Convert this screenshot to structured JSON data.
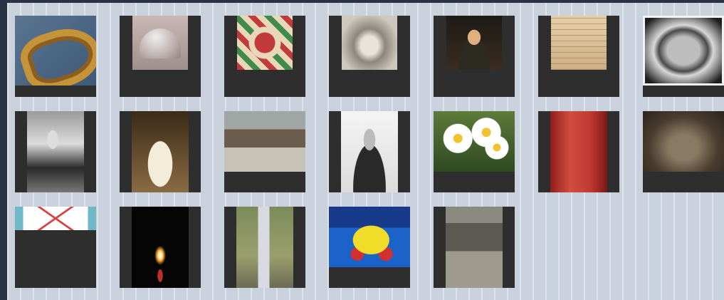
{
  "gallery": {
    "items": [
      {
        "name": "thumb-golden-knot",
        "fill": "bg-knot",
        "layout": "t-full"
      },
      {
        "name": "thumb-glass-dome",
        "fill": "bg-dome",
        "layout": "t-vert"
      },
      {
        "name": "thumb-tile-pattern",
        "fill": "bg-tile",
        "layout": "t-vert"
      },
      {
        "name": "thumb-sepia-person",
        "fill": "bg-sepia-person",
        "layout": "t-vert"
      },
      {
        "name": "thumb-painted-portrait",
        "fill": "bg-portrait",
        "layout": "t-vert"
      },
      {
        "name": "thumb-handwritten-page",
        "fill": "bg-paper",
        "layout": "t-vert"
      },
      {
        "name": "thumb-framed-photo",
        "fill": "bg-photo-frame",
        "layout": "t-full"
      },
      {
        "name": "thumb-woman-portrait",
        "fill": "bg-woman-bw",
        "layout": "t-centered"
      },
      {
        "name": "thumb-baby-photo",
        "fill": "bg-baby",
        "layout": "t-centered"
      },
      {
        "name": "thumb-street-crowd",
        "fill": "bg-street",
        "layout": "t-wide"
      },
      {
        "name": "thumb-man-in-hat",
        "fill": "bg-man-hat",
        "layout": "t-centered"
      },
      {
        "name": "thumb-daisies",
        "fill": "bg-daisy",
        "layout": "t-wide"
      },
      {
        "name": "thumb-red-book",
        "fill": "bg-redbook",
        "layout": "t-centered"
      },
      {
        "name": "thumb-rock-texture",
        "fill": "bg-rock",
        "layout": "t-wide"
      },
      {
        "name": "thumb-diagram",
        "fill": "bg-diagram",
        "layout": "t-band"
      },
      {
        "name": "thumb-candle",
        "fill": "bg-candle",
        "layout": "t-centered"
      },
      {
        "name": "thumb-stone-marker",
        "fill": "bg-marker",
        "layout": "t-centered"
      },
      {
        "name": "thumb-yellow-car",
        "fill": "bg-car",
        "layout": "t-wide"
      },
      {
        "name": "thumb-old-street",
        "fill": "bg-oldstreet",
        "layout": "t-centered"
      }
    ]
  },
  "colors": {
    "page_background": "#2a3346",
    "panel_background": "#c9d1dc",
    "tile_background": "#2e2e2e"
  }
}
